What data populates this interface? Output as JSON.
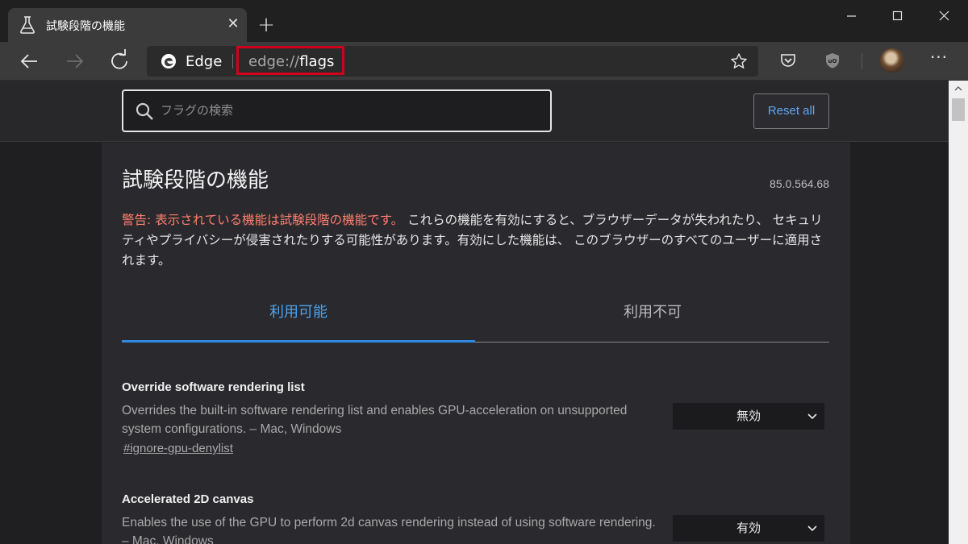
{
  "tab": {
    "title": "試験段階の機能",
    "icon": "flask-icon"
  },
  "window_controls": [
    "minimize-icon",
    "maximize-icon",
    "close-icon"
  ],
  "toolbar": {
    "site_label": "Edge",
    "url_scheme": "edge://",
    "url_path": "flags"
  },
  "search": {
    "placeholder": "フラグの検索",
    "value": ""
  },
  "reset_label": "Reset all",
  "page": {
    "title": "試験段階の機能",
    "version": "85.0.564.68",
    "warning_red": "警告: 表示されている機能は試験段階の機能です。",
    "warning_text": "これらの機能を有効にすると、ブラウザーデータが失われたり、 セキュリティやプライバシーが侵害されたりする可能性があります。有効にした機能は、 このブラウザーのすべてのユーザーに適用されます。"
  },
  "tabs": [
    {
      "label": "利用可能",
      "active": true
    },
    {
      "label": "利用不可",
      "active": false
    }
  ],
  "flags": [
    {
      "name": "Override software rendering list",
      "description": "Overrides the built-in software rendering list and enables GPU-acceleration on unsupported system configurations. – Mac, Windows",
      "link": "#ignore-gpu-denylist",
      "value": "無効"
    },
    {
      "name": "Accelerated 2D canvas",
      "description": "Enables the use of the GPU to perform 2d canvas rendering instead of using software rendering. – Mac, Windows",
      "value": "有効"
    }
  ],
  "colors": {
    "accent": "#2f89e0",
    "warning": "#ff7d6e",
    "highlight": "#d0021b"
  }
}
